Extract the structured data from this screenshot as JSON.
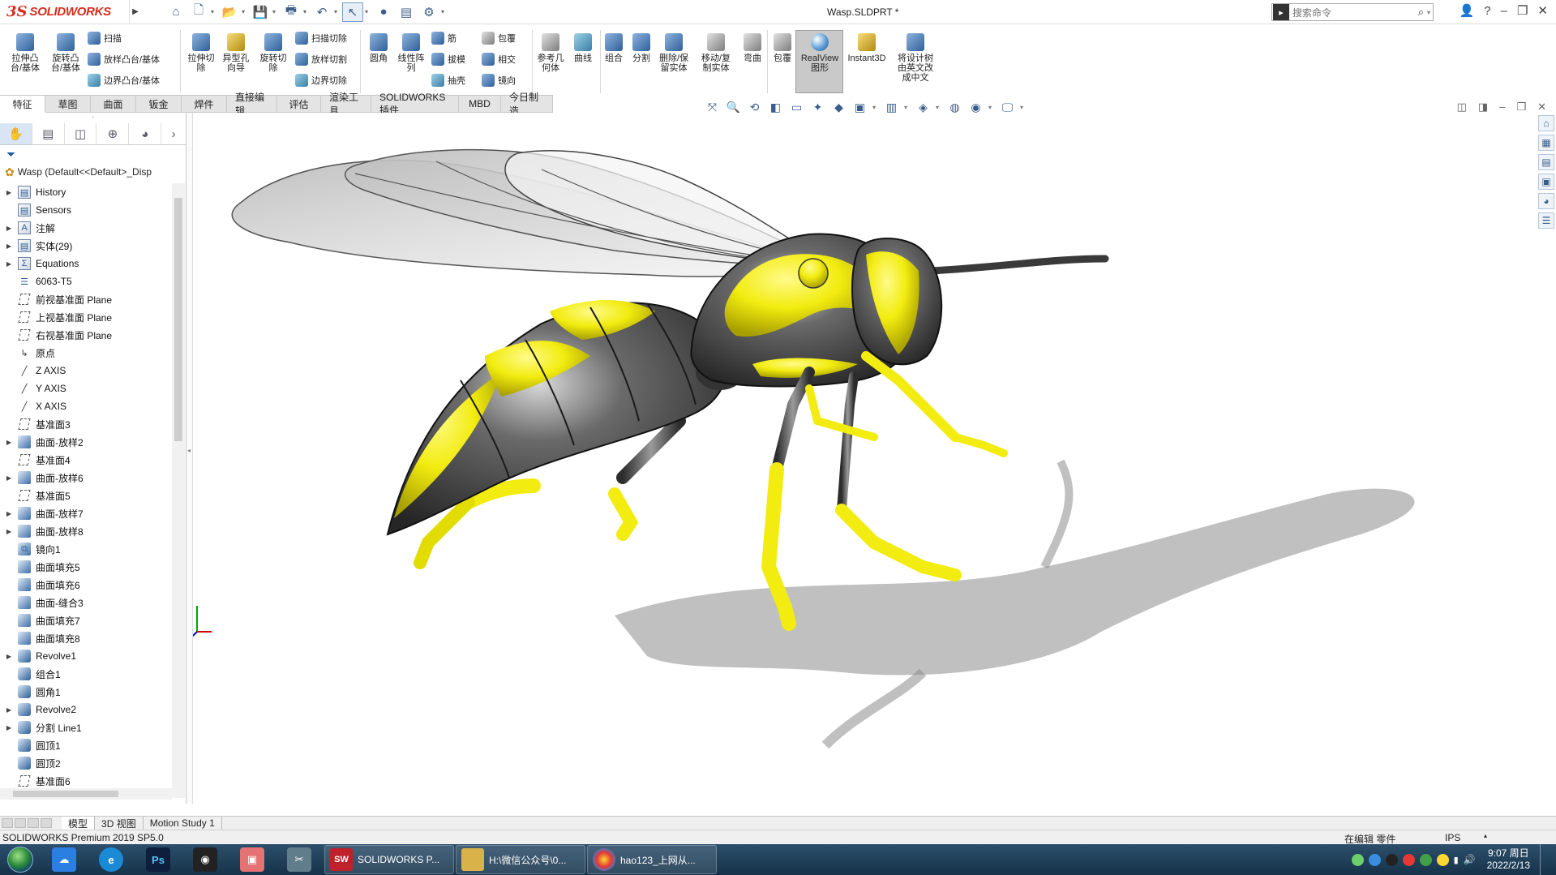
{
  "app": {
    "logo_prefix": "3S",
    "logo_text": "SOLIDWORKS",
    "document_title": "Wasp.SLDPRT *",
    "search_placeholder": "搜索命令"
  },
  "command_manager": {
    "big": [
      {
        "id": "extrude-boss",
        "label": "拉伸凸\n台/基体"
      },
      {
        "id": "revolve-boss",
        "label": "旋转凸\n台/基体"
      },
      {
        "id": "extrude-cut",
        "label": "拉伸切\n除"
      },
      {
        "id": "hole-wizard",
        "label": "异型孔\n向导"
      },
      {
        "id": "revolve-cut",
        "label": "旋转切\n除"
      },
      {
        "id": "fillet",
        "label": "圆角"
      },
      {
        "id": "linear-pattern",
        "label": "线性阵\n列"
      },
      {
        "id": "ref-geometry",
        "label": "参考几\n何体"
      },
      {
        "id": "curves",
        "label": "曲线"
      },
      {
        "id": "combine",
        "label": "组合"
      },
      {
        "id": "split",
        "label": "分割"
      },
      {
        "id": "delete-keep-body",
        "label": "删除/保\n留实体"
      },
      {
        "id": "move-copy-body",
        "label": "移动/复\n制实体"
      },
      {
        "id": "flex",
        "label": "弯曲"
      },
      {
        "id": "wrap-big",
        "label": "包覆"
      },
      {
        "id": "realview",
        "label": "RealView\n图形"
      },
      {
        "id": "instant3d",
        "label": "Instant3D"
      },
      {
        "id": "translate-tree",
        "label": "将设计树\n由英文改\n成中文"
      }
    ],
    "small": [
      {
        "id": "sweep",
        "label": "扫描"
      },
      {
        "id": "loft",
        "label": "放样凸台/基体"
      },
      {
        "id": "boundary",
        "label": "边界凸台/基体"
      },
      {
        "id": "swept-cut",
        "label": "扫描切除"
      },
      {
        "id": "lofted-cut",
        "label": "放样切割"
      },
      {
        "id": "boundary-cut",
        "label": "边界切除"
      },
      {
        "id": "rib",
        "label": "筋"
      },
      {
        "id": "draft",
        "label": "拔模"
      },
      {
        "id": "shell",
        "label": "抽壳"
      },
      {
        "id": "wrap",
        "label": "包覆"
      },
      {
        "id": "intersect",
        "label": "相交"
      },
      {
        "id": "mirror",
        "label": "镜向"
      }
    ]
  },
  "tabs": [
    "特征",
    "草图",
    "曲面",
    "钣金",
    "焊件",
    "直接编辑",
    "评估",
    "渲染工具",
    "SOLIDWORKS 插件",
    "MBD",
    "今日制造"
  ],
  "feature_tree": {
    "root": "Wasp  (Default<<Default>_Disp",
    "items": [
      {
        "label": "History",
        "icon": "folder",
        "expand": true
      },
      {
        "label": "Sensors",
        "icon": "folder",
        "expand": false
      },
      {
        "label": "注解",
        "icon": "annotation",
        "expand": true
      },
      {
        "label": "实体(29)",
        "icon": "folder",
        "expand": true
      },
      {
        "label": "Equations",
        "icon": "sigma",
        "expand": true
      },
      {
        "label": "6063-T5",
        "icon": "material",
        "expand": false
      },
      {
        "label": "前视基准面 Plane",
        "icon": "plane",
        "expand": false
      },
      {
        "label": "上视基准面 Plane",
        "icon": "plane",
        "expand": false
      },
      {
        "label": "右视基准面 Plane",
        "icon": "plane",
        "expand": false
      },
      {
        "label": "原点",
        "icon": "origin",
        "expand": false
      },
      {
        "label": "Z AXIS",
        "icon": "axis",
        "expand": false
      },
      {
        "label": "Y AXIS",
        "icon": "axis",
        "expand": false
      },
      {
        "label": "X AXIS",
        "icon": "axis",
        "expand": false
      },
      {
        "label": "基准面3",
        "icon": "plane",
        "expand": false
      },
      {
        "label": "曲面-放样2",
        "icon": "surf",
        "expand": true
      },
      {
        "label": "基准面4",
        "icon": "plane",
        "expand": false
      },
      {
        "label": "曲面-放样6",
        "icon": "surf",
        "expand": true
      },
      {
        "label": "基准面5",
        "icon": "plane",
        "expand": false
      },
      {
        "label": "曲面-放样7",
        "icon": "surf",
        "expand": true
      },
      {
        "label": "曲面-放样8",
        "icon": "surf",
        "expand": true
      },
      {
        "label": "镜向1",
        "icon": "mirror",
        "expand": false
      },
      {
        "label": "曲面填充5",
        "icon": "surf",
        "expand": false
      },
      {
        "label": "曲面填充6",
        "icon": "surf",
        "expand": false
      },
      {
        "label": "曲面-缝合3",
        "icon": "surf",
        "expand": false
      },
      {
        "label": "曲面填充7",
        "icon": "surf",
        "expand": false
      },
      {
        "label": "曲面填充8",
        "icon": "surf",
        "expand": false
      },
      {
        "label": "Revolve1",
        "icon": "solid",
        "expand": true
      },
      {
        "label": "组合1",
        "icon": "solid",
        "expand": false
      },
      {
        "label": "圆角1",
        "icon": "solid",
        "expand": false
      },
      {
        "label": "Revolve2",
        "icon": "solid",
        "expand": true
      },
      {
        "label": "分割 Line1",
        "icon": "solid",
        "expand": true
      },
      {
        "label": "圆顶1",
        "icon": "solid",
        "expand": false
      },
      {
        "label": "圆顶2",
        "icon": "solid",
        "expand": false
      },
      {
        "label": "基准面6",
        "icon": "plane",
        "expand": false
      }
    ]
  },
  "bottom_tabs": [
    "模型",
    "3D 视图",
    "Motion Study 1"
  ],
  "status": {
    "left": "SOLIDWORKS Premium 2019 SP5.0",
    "mode": "在编辑 零件",
    "units": "IPS"
  },
  "taskbar": {
    "tasks": [
      {
        "label": "SOLIDWORKS P...",
        "icon_text": "SW",
        "color": "#c0202a"
      },
      {
        "label": "H:\\微信公众号\\0...",
        "icon_text": "",
        "color": "#d9b34a"
      },
      {
        "label": "hao123_上网从...",
        "icon_text": "",
        "color": "#3b8de0"
      }
    ],
    "time": "9:07 周日",
    "date": "2022/2/13"
  },
  "colors": {
    "wasp_yellow": "#f2ec10",
    "wasp_body": "#3a3a3a",
    "accent_red": "#d52b1e"
  }
}
